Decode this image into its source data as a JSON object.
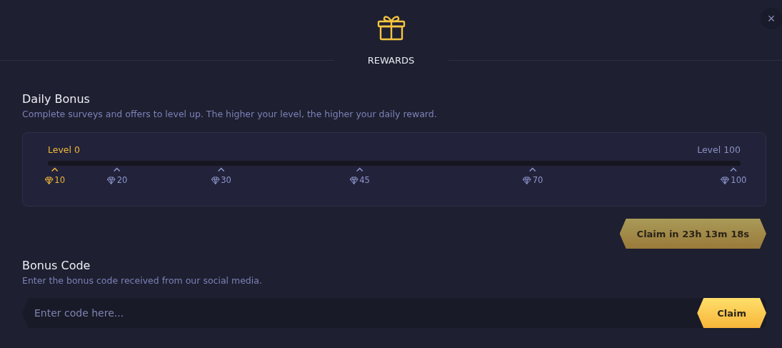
{
  "header": {
    "title": "REWARDS",
    "close": "×"
  },
  "daily_bonus": {
    "title": "Daily Bonus",
    "description": "Complete surveys and offers to level up. The higher your level, the higher your daily reward.",
    "progress": {
      "start_label": "Level 0",
      "end_label": "Level 100",
      "milestones": [
        {
          "reward": "10",
          "reached": true
        },
        {
          "reward": "20",
          "reached": false
        },
        {
          "reward": "30",
          "reached": false
        },
        {
          "reward": "45",
          "reached": false
        },
        {
          "reward": "70",
          "reached": false
        },
        {
          "reward": "100",
          "reached": false
        }
      ]
    },
    "claim_button": {
      "label": "Claim in 23h 13m 18s",
      "disabled": true
    }
  },
  "bonus_code": {
    "title": "Bonus Code",
    "description": "Enter the bonus code received from our social media.",
    "input": {
      "placeholder": "Enter code here..."
    },
    "claim_button": {
      "label": "Claim",
      "disabled": false
    }
  }
}
